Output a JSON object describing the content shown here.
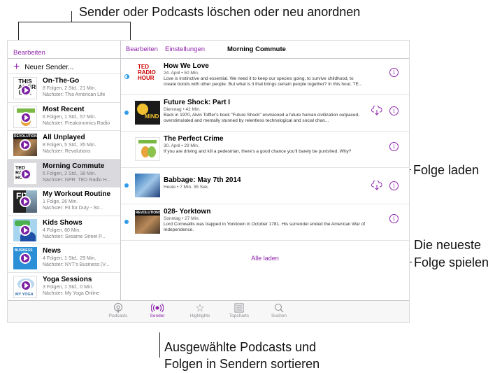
{
  "callouts": {
    "top": "Sender oder Podcasts löschen oder neu anordnen",
    "download": "Folge laden",
    "play_line1": "Die neueste",
    "play_line2": "Folge spielen",
    "bottom_line1": "Ausgewählte Podcasts und",
    "bottom_line2": "Folgen in Sendern sortieren"
  },
  "colors": {
    "accent": "#8e24aa",
    "unplayed_dot": "#2f9bea",
    "selected_row": "#d9d9de"
  },
  "sidebar": {
    "edit_label": "Bearbeiten",
    "new_station_label": "Neuer Sender...",
    "stations": [
      {
        "title": "On-The-Go",
        "line1": "8 Folgen, 2 Std., 21 Min.",
        "line2": "Nächster: This American Life",
        "art": "this-american-life"
      },
      {
        "title": "Most Recent",
        "line1": "6 Folgen, 1 Std., 57 Min.",
        "line2": "Nächster: Freakonomics Radio",
        "art": "freakonomics"
      },
      {
        "title": "All Unplayed",
        "line1": "8 Folgen, 5 Std., 35 Min.",
        "line2": "Nächster: Revolutions",
        "art": "revolutions"
      },
      {
        "title": "Morning Commute",
        "line1": "5 Folgen, 2 Std., 38 Min.",
        "line2": "Nächster: NPR: TED Radio H...",
        "art": "ted-radio-hour"
      },
      {
        "title": "My Workout Routine",
        "line1": "1 Folge, 26 Min.",
        "line2": "Nächster: Fit for Duty - Str...",
        "art": "fit"
      },
      {
        "title": "Kids Shows",
        "line1": "4 Folgen, 60 Min.",
        "line2": "Nächster: Sesame Street P...",
        "art": "sesame-street"
      },
      {
        "title": "News",
        "line1": "4 Folgen, 1 Std., 29 Min.",
        "line2": "Nächster: NYT's Business (V...",
        "art": "business"
      },
      {
        "title": "Yoga Sessions",
        "line1": "3 Folgen, 1 Std., 0 Min.",
        "line2": "Nächster: My Yoga Online",
        "art": "my-yoga"
      }
    ],
    "art_text": {
      "this_american_life": "THIS AMERICAN LIFE",
      "ted": "TED RADIO HOUR",
      "revolutions": "REVOLUTIONS",
      "fit": "FIT",
      "business": "BUSINESS",
      "yoga": "MY YOGA"
    }
  },
  "main": {
    "edit_label": "Bearbeiten",
    "settings_label": "Einstellungen",
    "title": "Morning Commute",
    "episodes": [
      {
        "title": "How We Love",
        "meta": "24. April • 50 Min.",
        "desc": "Love is instinctive and essential. We need it to keep our species going, to survive childhood, to create bonds with other people. But what is it that brings certain people together? In this hour, TE...",
        "art_text": "TED RADIO HOUR"
      },
      {
        "title": "Future Shock: Part I",
        "meta": "Dienstag • 42 Min.",
        "desc": "Back in 1970, Alvin Toffler's book \"Future Shock\" envisioned a future human civilization outpaced, overstimulated and mentally stunned by relentless technological and social chan...",
        "art_text": "MIND"
      },
      {
        "title": "The Perfect Crime",
        "meta": "30. April • 29 Min.",
        "desc": "If you are driving and kill a pedestrian, there's a good chance you'll barely be punished. Why?",
        "art_text": ""
      },
      {
        "title": "Babbage: May 7th 2014",
        "meta": "Heute • 7 Min. 35 Sek.",
        "desc": "",
        "art_text": ""
      },
      {
        "title": "028- Yorktown",
        "meta": "Sonntag • 27 Min.",
        "desc": "Lord Cornwallis was trapped in Yorktown in October 1781. His surrender ended the American War of Independence.",
        "art_text": "REVOLUTIONS"
      }
    ],
    "load_all_label": "Alle laden"
  },
  "tabbar": {
    "tabs": [
      {
        "label": "Podcasts",
        "icon": "podcasts-icon"
      },
      {
        "label": "Sender",
        "icon": "stations-icon"
      },
      {
        "label": "Highlights",
        "icon": "star-icon"
      },
      {
        "label": "Topcharts",
        "icon": "list-icon"
      },
      {
        "label": "Suchen",
        "icon": "search-icon"
      }
    ]
  }
}
